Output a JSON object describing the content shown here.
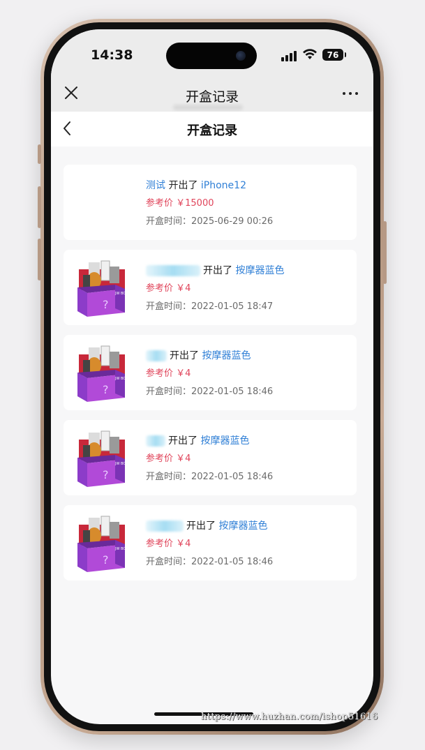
{
  "status_bar": {
    "time": "14:38",
    "battery": "76"
  },
  "nav": {
    "title": "开盒记录",
    "close_icon": "close-icon",
    "more_icon": "more-icon"
  },
  "page": {
    "title": "开盒记录",
    "back_icon": "chevron-left-icon"
  },
  "records": [
    {
      "user": "测试",
      "action": "开出了",
      "product": "iPhone12",
      "price": "参考价 ￥15000",
      "time": "开盒时间：2025-06-29 00:26",
      "has_image": false
    },
    {
      "user": "",
      "action": "开出了",
      "product": "按摩器蓝色",
      "price": "参考价 ￥4",
      "time": "开盒时间：2022-01-05 18:47",
      "has_image": true
    },
    {
      "user": "",
      "action": "开出了",
      "product": "按摩器蓝色",
      "price": "参考价 ￥4",
      "time": "开盒时间：2022-01-05 18:46",
      "has_image": true
    },
    {
      "user": "",
      "action": "开出了",
      "product": "按摩器蓝色",
      "price": "参考价 ￥4",
      "time": "开盒时间：2022-01-05 18:46",
      "has_image": true
    },
    {
      "user": "",
      "action": "开出了",
      "product": "按摩器蓝色",
      "price": "参考价 ￥4",
      "time": "开盒时间：2022-01-05 18:46",
      "has_image": true
    }
  ],
  "watermark": "https://www.huzhan.com/ishop51616",
  "colors": {
    "link": "#2f7fd6",
    "price": "#e0445a",
    "box_purple": "#b14ad8",
    "box_red": "#c8283a"
  }
}
